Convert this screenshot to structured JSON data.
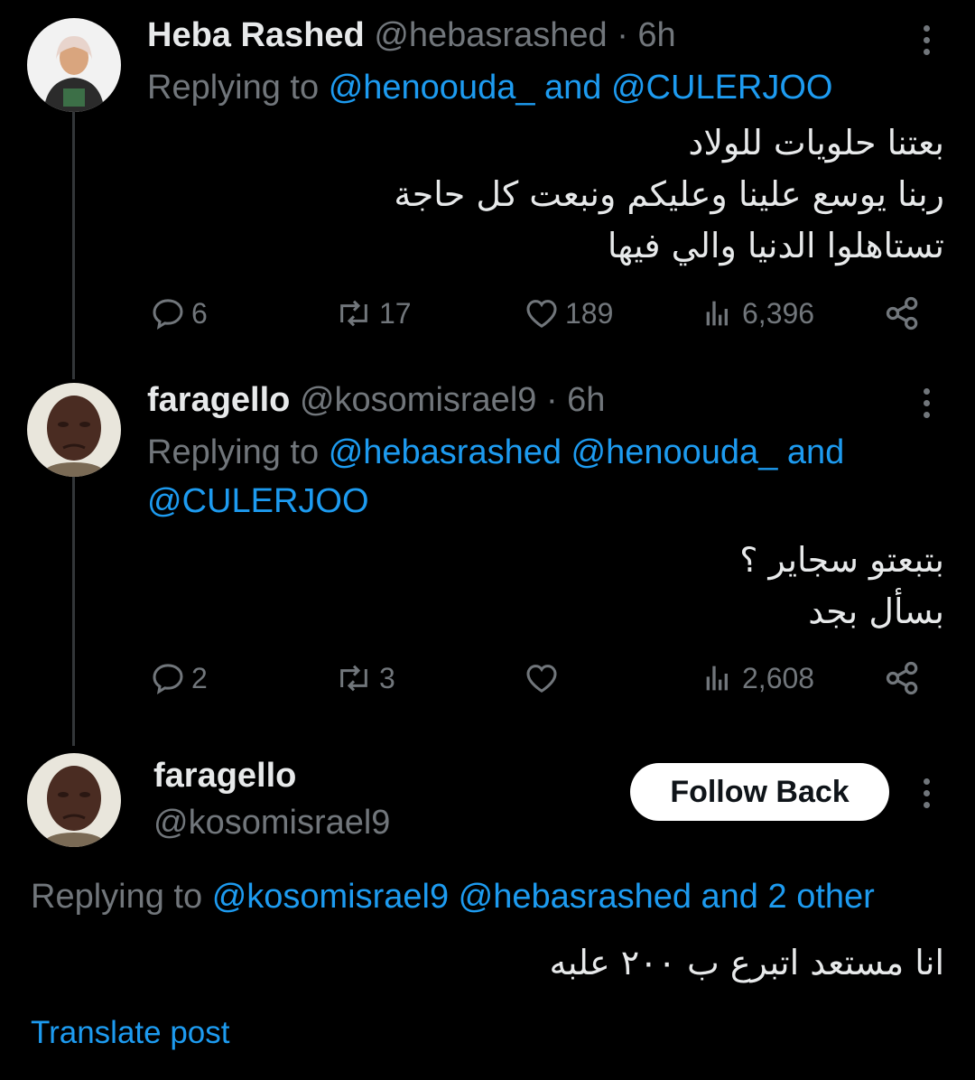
{
  "tweets": [
    {
      "display_name": "Heba Rashed",
      "handle": "@hebasrashed",
      "time": "· 6h",
      "replying_prefix": "Replying to",
      "mention_1": "@henoouda_ and @CULERJOO",
      "body_lines": [
        "بعتنا حلويات للولاد",
        "ربنا يوسع علينا وعليكم ونبعت كل حاجة",
        "تستاهلوا الدنيا والي فيها"
      ],
      "replies": "6",
      "reposts": "17",
      "likes": "189",
      "views": "6,396"
    },
    {
      "display_name": "faragello",
      "handle": "@kosomisrael9",
      "time": "· 6h",
      "replying_prefix": "Replying to",
      "mention_1": "@hebasrashed @henoouda_ and",
      "mention_2": "@CULERJOO",
      "body_lines": [
        "بتبعتو سجاير ؟",
        "بسأل بجد"
      ],
      "replies": "2",
      "reposts": "3",
      "likes": "",
      "views": "2,608"
    },
    {
      "display_name": "faragello",
      "handle": "@kosomisrael9",
      "follow_label": "Follow Back",
      "replying_prefix": "Replying to",
      "mentions": "@kosomisrael9 @hebasrashed and 2 other",
      "body_lines": [
        "انا مستعد اتبرع ب ٢٠٠ علبه"
      ],
      "translate_label": "Translate post"
    }
  ],
  "colors": {
    "background": "#000000",
    "text": "#e7e9ea",
    "muted": "#71767b",
    "link": "#1d9bf0"
  },
  "icons": [
    "reply-icon",
    "repost-icon",
    "like-icon",
    "views-icon",
    "share-icon",
    "more-icon"
  ]
}
